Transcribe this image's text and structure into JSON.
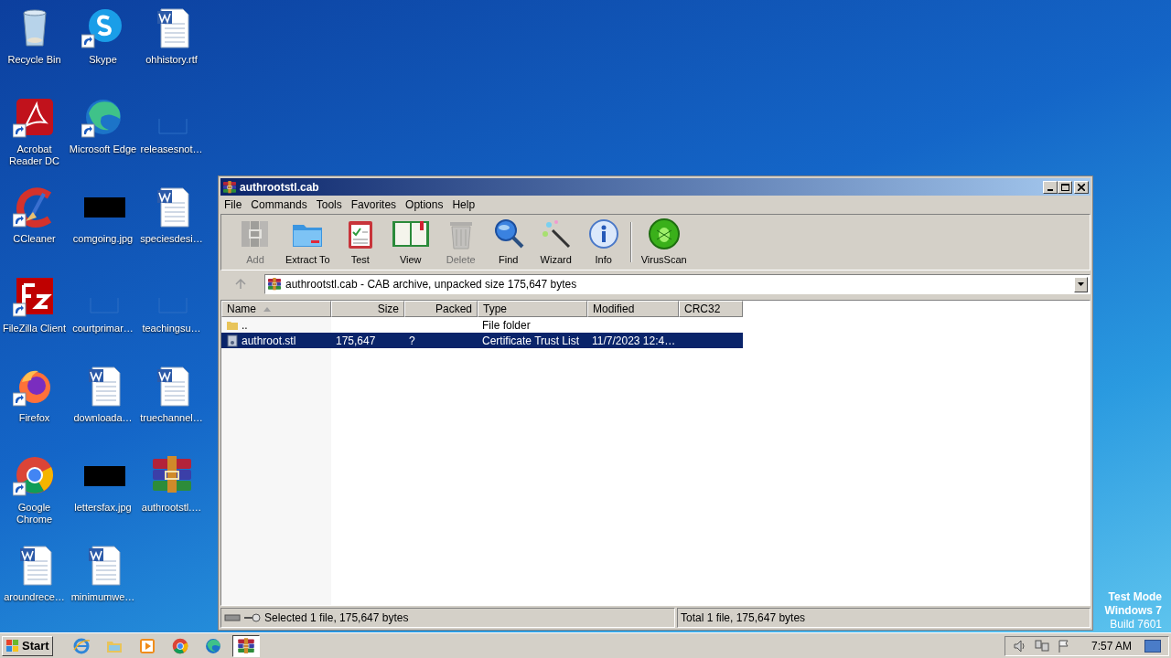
{
  "desktop": {
    "icons": [
      {
        "label": "Recycle Bin",
        "kind": "recycle",
        "shortcut": false
      },
      {
        "label": "Skype",
        "kind": "skype",
        "shortcut": true
      },
      {
        "label": "ohhistory.rtf",
        "kind": "word",
        "shortcut": false
      },
      {
        "label": "Acrobat Reader DC",
        "kind": "acrobat",
        "shortcut": true
      },
      {
        "label": "Microsoft Edge",
        "kind": "edge",
        "shortcut": true
      },
      {
        "label": "releasesnot…",
        "kind": "blank",
        "shortcut": false
      },
      {
        "label": "CCleaner",
        "kind": "ccleaner",
        "shortcut": true
      },
      {
        "label": "comgoing.jpg",
        "kind": "dark",
        "shortcut": false
      },
      {
        "label": "speciesdesi…",
        "kind": "word",
        "shortcut": false
      },
      {
        "label": "FileZilla Client",
        "kind": "filezilla",
        "shortcut": true
      },
      {
        "label": "courtprimar…",
        "kind": "blank",
        "shortcut": false
      },
      {
        "label": "teachingsu…",
        "kind": "blank",
        "shortcut": false
      },
      {
        "label": "Firefox",
        "kind": "firefox",
        "shortcut": true
      },
      {
        "label": "downloada…",
        "kind": "word",
        "shortcut": false
      },
      {
        "label": "truechannel…",
        "kind": "word",
        "shortcut": false
      },
      {
        "label": "Google Chrome",
        "kind": "chrome",
        "shortcut": true
      },
      {
        "label": "lettersfax.jpg",
        "kind": "dark",
        "shortcut": false
      },
      {
        "label": "authrootstl.…",
        "kind": "winrar",
        "shortcut": false
      },
      {
        "label": "aroundrece…",
        "kind": "word",
        "shortcut": false
      },
      {
        "label": "minimumwe…",
        "kind": "word",
        "shortcut": false
      }
    ],
    "os_notice": [
      "Test Mode",
      "Windows 7",
      "Build 7601"
    ]
  },
  "window": {
    "title": "authrootstl.cab",
    "menu": [
      "File",
      "Commands",
      "Tools",
      "Favorites",
      "Options",
      "Help"
    ],
    "toolbar": {
      "main": [
        {
          "label": "Add",
          "kind": "add",
          "disabled": true
        },
        {
          "label": "Extract To",
          "kind": "extract",
          "disabled": false
        },
        {
          "label": "Test",
          "kind": "test",
          "disabled": false
        },
        {
          "label": "View",
          "kind": "view",
          "disabled": false
        },
        {
          "label": "Delete",
          "kind": "delete",
          "disabled": true
        },
        {
          "label": "Find",
          "kind": "find",
          "disabled": false
        },
        {
          "label": "Wizard",
          "kind": "wizard",
          "disabled": false
        },
        {
          "label": "Info",
          "kind": "info",
          "disabled": false
        }
      ],
      "extra": [
        {
          "label": "VirusScan",
          "kind": "virus",
          "disabled": false
        }
      ]
    },
    "address": "authrootstl.cab - CAB archive, unpacked size 175,647 bytes",
    "table": {
      "columns": [
        {
          "label": "Name",
          "sorted": true
        },
        {
          "label": "Size",
          "sorted": false
        },
        {
          "label": "Packed",
          "sorted": false
        },
        {
          "label": "Type",
          "sorted": false
        },
        {
          "label": "Modified",
          "sorted": false
        },
        {
          "label": "CRC32",
          "sorted": false
        }
      ],
      "rows": [
        {
          "kind": "folder",
          "selected": false,
          "cells": [
            "..",
            "",
            "",
            "File folder",
            "",
            ""
          ]
        },
        {
          "kind": "file",
          "selected": true,
          "cells": [
            "authroot.stl",
            "175,647",
            "?",
            "Certificate Trust List",
            "11/7/2023 12:4…",
            ""
          ]
        }
      ]
    },
    "status_bar": [
      "Selected 1 file, 175,647 bytes",
      "Total 1 file, 175,647 bytes"
    ]
  },
  "taskbar": {
    "start": "Start",
    "apps": [
      {
        "kind": "ie",
        "selected": false
      },
      {
        "kind": "explorer",
        "selected": false
      },
      {
        "kind": "media",
        "selected": false
      },
      {
        "kind": "chrome",
        "selected": false
      },
      {
        "kind": "edge",
        "selected": false
      },
      {
        "kind": "winrar",
        "selected": true
      }
    ],
    "clock": "7:57 AM"
  }
}
